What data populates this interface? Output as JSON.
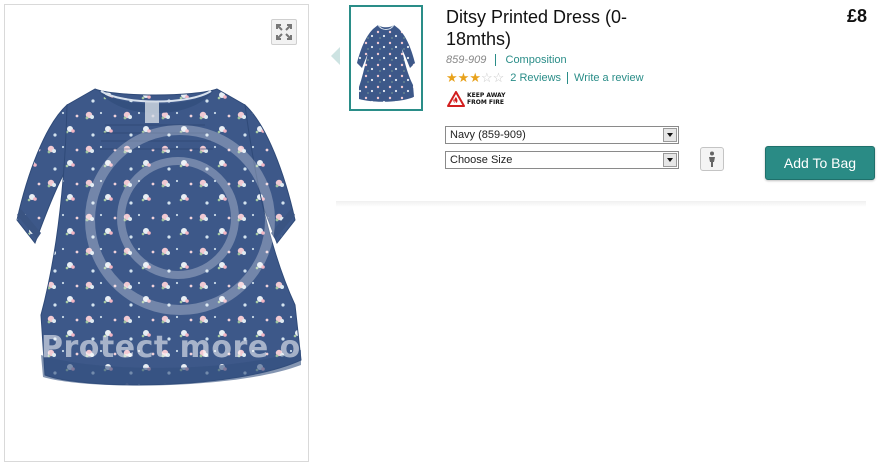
{
  "product": {
    "title": "Ditsy Printed Dress (0-18mths)",
    "price": "£8",
    "code": "859-909",
    "composition_link": "Composition",
    "rating": 3,
    "rating_max": 5,
    "reviews_link": "2 Reviews",
    "write_review_link": "Write a review",
    "fire_warning": "KEEP AWAY FROM FIRE"
  },
  "image": {
    "watermark_text": "Protect more of"
  },
  "options": {
    "colour_selected": "Navy (859-909)",
    "size_selected": "Choose Size"
  },
  "actions": {
    "add_to_bag": "Add To Bag"
  },
  "icons": {
    "expand": "expand-icon",
    "prev": "chevron-left-icon",
    "size_guide": "person-icon",
    "fire": "fire-warning-icon"
  },
  "colors": {
    "accent": "#2a8b85",
    "star": "#e8a21c",
    "dress_navy": "#3c5788"
  }
}
